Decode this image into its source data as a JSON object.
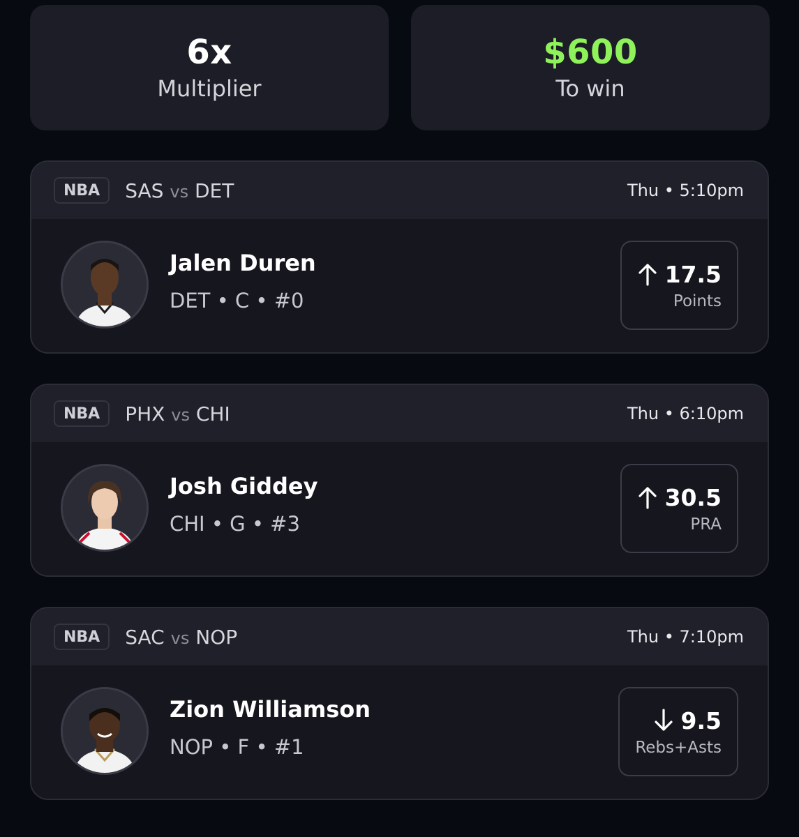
{
  "summary": {
    "multiplier_value": "6x",
    "multiplier_label": "Multiplier",
    "payout_value": "$600",
    "payout_label": "To win",
    "payout_color": "#8ff25a"
  },
  "picks": [
    {
      "league": "NBA",
      "home": "SAS",
      "vs": "vs",
      "away": "DET",
      "time": "Thu • 5:10pm",
      "player": "Jalen Duren",
      "meta": "DET • C • #0",
      "direction": "up",
      "direction_icon": "arrow-up-icon",
      "line": "17.5",
      "stat": "Points"
    },
    {
      "league": "NBA",
      "home": "PHX",
      "vs": "vs",
      "away": "CHI",
      "time": "Thu • 6:10pm",
      "player": "Josh Giddey",
      "meta": "CHI • G • #3",
      "direction": "up",
      "direction_icon": "arrow-up-icon",
      "line": "30.5",
      "stat": "PRA"
    },
    {
      "league": "NBA",
      "home": "SAC",
      "vs": "vs",
      "away": "NOP",
      "time": "Thu • 7:10pm",
      "player": "Zion Williamson",
      "meta": "NOP • F • #1",
      "direction": "down",
      "direction_icon": "arrow-down-icon",
      "line": "9.5",
      "stat": "Rebs+Asts"
    }
  ]
}
